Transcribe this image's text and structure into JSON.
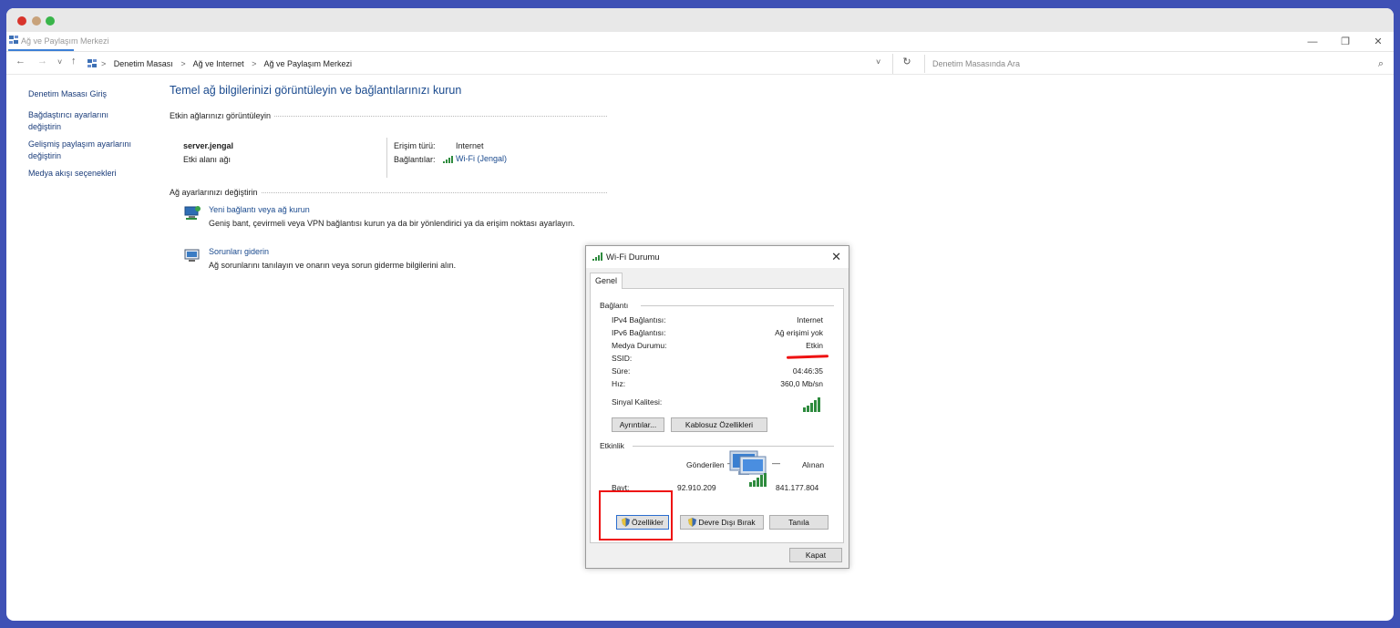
{
  "window": {
    "title": "Ağ ve Paylaşım Merkezi",
    "controls": {
      "minimize": "—",
      "restore": "❐",
      "close": "✕"
    }
  },
  "address": {
    "back": "←",
    "forward": "→",
    "dropdown": "˅",
    "up": "↑",
    "crumbs": [
      "Denetim Masası",
      "Ağ ve Internet",
      "Ağ ve Paylaşım Merkezi"
    ],
    "crumb_sep": ">",
    "addr_dropdown": "˅",
    "refresh": "↻",
    "search_placeholder": "Denetim Masasında Ara",
    "search_icon": "⌕"
  },
  "sidebar": {
    "items": [
      {
        "label": "Denetim Masası Giriş"
      },
      {
        "label": "Bağdaştırıcı ayarlarını değiştirin"
      },
      {
        "label": "Gelişmiş paylaşım ayarlarını değiştirin"
      },
      {
        "label": "Medya akışı seçenekleri"
      }
    ]
  },
  "main": {
    "title": "Temel ağ bilgilerinizi görüntüleyin ve bağlantılarınızı kurun",
    "active_networks_label": "Etkin ağlarınızı görüntüleyin",
    "network": {
      "name": "server.jengal",
      "type": "Etki alanı ağı",
      "access_label": "Erişim türü:",
      "access_value": "Internet",
      "connections_label": "Bağlantılar:",
      "connections_value": "Wi-Fi (Jengal)"
    },
    "change_settings_label": "Ağ ayarlarınızı değiştirin",
    "tasks": [
      {
        "link": "Yeni bağlantı veya ağ kurun",
        "desc": "Geniş bant, çevirmeli veya VPN bağlantısı kurun ya da bir yönlendirici ya da erişim noktası ayarlayın."
      },
      {
        "link": "Sorunları giderin",
        "desc": "Ağ sorunlarını tanılayın ve onarın veya sorun giderme bilgilerini alın."
      }
    ]
  },
  "dialog": {
    "title": "Wi-Fi Durumu",
    "close": "✕",
    "tab": "Genel",
    "connection_group": "Bağlantı",
    "rows": [
      {
        "key": "IPv4 Bağlantısı:",
        "value": "Internet"
      },
      {
        "key": "IPv6 Bağlantısı:",
        "value": "Ağ erişimi yok"
      },
      {
        "key": "Medya Durumu:",
        "value": "Etkin"
      },
      {
        "key": "SSID:",
        "value": ""
      },
      {
        "key": "Süre:",
        "value": "04:46:35"
      },
      {
        "key": "Hız:",
        "value": "360,0 Mb/sn"
      }
    ],
    "signal_label": "Sinyal Kalitesi:",
    "details_button": "Ayrıntılar...",
    "wireless_props_button": "Kablosuz Özellikleri",
    "activity_group": "Etkinlik",
    "sent_label": "Gönderilen",
    "received_label": "Alınan",
    "dash": "—",
    "bytes_label": "Bayt:",
    "bytes_sent": "92.910.209",
    "bytes_received": "841.177.804",
    "properties_button": "Özellikler",
    "disable_button": "Devre Dışı Bırak",
    "diagnose_button": "Tanıla",
    "close_button": "Kapat"
  },
  "colors": {
    "frame_bg": "#3f51b5",
    "link_blue": "#1a4a8e",
    "annotation_red": "#e11111",
    "signal_green": "#2e8b3e"
  }
}
